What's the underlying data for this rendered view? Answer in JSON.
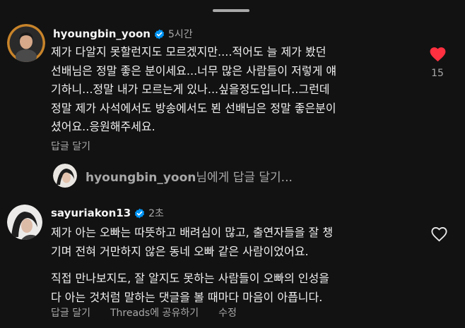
{
  "comments": [
    {
      "username": "hyoungbin_yoon",
      "time": "5시간",
      "verified": true,
      "text_lines": [
        "제가 다알지 못할런지도 모르겠지만....적어도 늘 제가 봤던",
        "선배님은 정말 좋은 분이세요...너무 많은 사람들이 저렇게 얘",
        "기하니...정말 내가 모르는게 있나...싶을정도입니다..그런데",
        "정말 제가 사석에서도 방송에서도 뵌 선배님은 정말 좋은분이",
        "셨어요..응원해주세요."
      ],
      "reply_label": "답글 달기",
      "liked": true,
      "like_count": "15",
      "like_color": "#ff3040"
    },
    {
      "username": "sayuriakon13",
      "time": "2초",
      "verified": true,
      "text_lines": [
        "제가 아는 오빠는 따뜻하고 배려심이 많고, 출연자들을 잘 챙",
        "기며 전혀 거만하지 않은 동네 오빠 같은 사람이었어요.",
        "",
        "직접 만나보지도, 잘 알지도 못하는 사람들이 오빠의 인성을",
        "다 아는 것처럼 말하는 댓글을 볼 때마다 마음이 아픕니다."
      ],
      "reply_label": "답글 달기",
      "share_label": "Threads에 공유하기",
      "edit_label": "수정",
      "liked": false
    }
  ],
  "reply_input": {
    "username": "hyoungbin_yoon",
    "suffix": "님에게 답글 달기..."
  },
  "colors": {
    "background": "#121212",
    "verified_badge": "#0095f6",
    "secondary_text": "#a8a8a8"
  }
}
